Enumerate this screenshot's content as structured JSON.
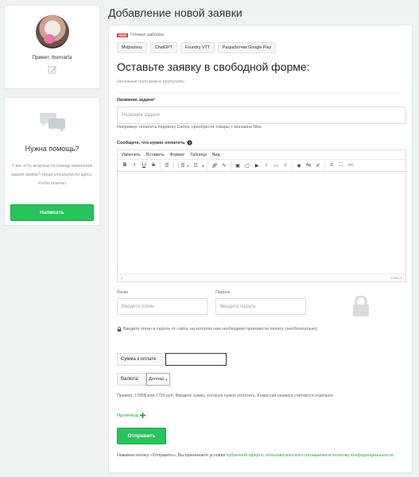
{
  "sidebar": {
    "greeting": "Привет, themarfa",
    "help": {
      "title": "Нужна помощь?",
      "text": "У вас есть вопросы по поводу изменения вашей заявки? Наши специалисты здесь, чтобы помочь!",
      "button_label": "Написать"
    }
  },
  "page": {
    "title": "Добавление новой заявки"
  },
  "templates": {
    "badge": "NEW",
    "label": "Готовые шаблоны",
    "items": [
      "Midjourney",
      "ChatGPT",
      "Foundry VTT",
      "Разработчик Google Play"
    ]
  },
  "form": {
    "title": "Оставьте заявку в свободной форме:",
    "optional_note": "Ненужные поля можно пропускать",
    "task_name": {
      "label": "Название задачи",
      "required_mark": "*",
      "placeholder": "Название задачи",
      "hint": "Например: оплатить подписку Canva, приобрести товары с магазина Nike."
    },
    "details": {
      "label": "Сообщите, что нужно оплатить",
      "menubar": [
        "Изменить",
        "Вставить",
        "Формат",
        "Таблица",
        "Вид"
      ],
      "status_left": "p",
      "status_right": "слов: 0"
    },
    "login": {
      "label": "Логин",
      "placeholder": "Введите логин"
    },
    "password": {
      "label": "Пароль",
      "placeholder": "Введите пароль"
    },
    "credentials_hint": "Введите логин и пароль от сайта, на котором нам необходимо произвести оплату. (необязательно)",
    "amount_label": "Сумма к оплате:",
    "amount_value": "",
    "currency_label": "Валюта:",
    "currency_value": "Доллар",
    "amount_hint": "Пример: 1780$ или 2700 руб. Введите сумму, которую нужно оплатить. Комиссия сервиса считается отдельно.",
    "promo_label": "Промокод",
    "submit_label": "Отправить",
    "terms": {
      "prefix": "Нажимая кнопку «Отправить», Вы принимаете условия ",
      "link1": "публичной оферты",
      "sep1": ", ",
      "link2": "пользовательского соглашения",
      "sep2": " и ",
      "link3": "политику конфиденциальности",
      "suffix": "."
    }
  },
  "colors": {
    "accent": "#28c35b",
    "badge": "#e23b3b",
    "background": "#eef2f3"
  }
}
